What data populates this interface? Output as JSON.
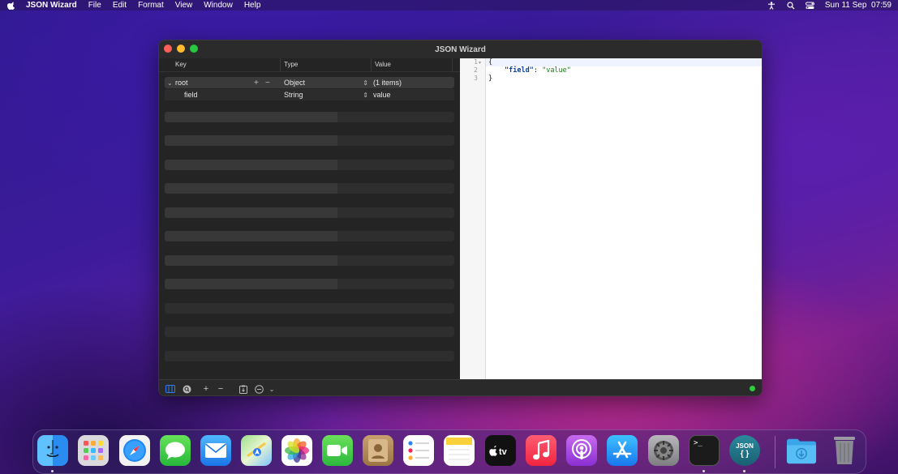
{
  "menubar": {
    "app_name": "JSON Wizard",
    "items": [
      "File",
      "Edit",
      "Format",
      "View",
      "Window",
      "Help"
    ],
    "clock": "Sun 11 Sep  07:59"
  },
  "window": {
    "title": "JSON Wizard",
    "columns": {
      "key": "Key",
      "type": "Type",
      "value": "Value"
    },
    "rows": [
      {
        "key": "root",
        "type": "Object",
        "value": "(1 items)"
      },
      {
        "key": "field",
        "type": "String",
        "value": "value"
      }
    ],
    "add_symbol": "+",
    "remove_symbol": "−"
  },
  "editor": {
    "line_numbers": [
      "1",
      "2",
      "3"
    ],
    "open_brace": "{",
    "field_key": "\"field\"",
    "colon": ": ",
    "field_value": "\"value\"",
    "close_brace": "}"
  },
  "bottombar": {
    "add": "+",
    "remove": "−"
  },
  "dock": {
    "json_label": "JSON",
    "json_braces": "{ }",
    "terminal_prompt": ">_"
  },
  "colors": {
    "status_ok": "#2ecc40",
    "accent": "#2f7cf6"
  }
}
